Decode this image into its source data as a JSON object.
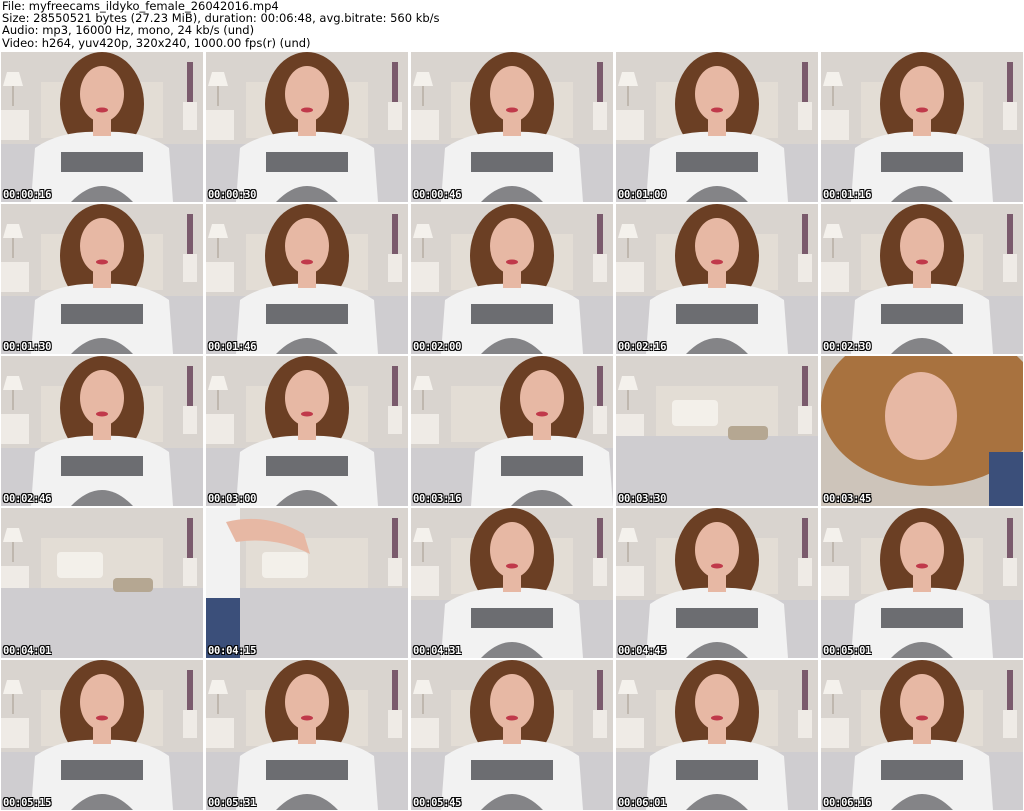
{
  "header": {
    "file_line": "File: myfreecams_ildyko_female_26042016.mp4",
    "size_line": "Size: 28550521 bytes (27.23 MiB), duration: 00:06:48, avg.bitrate: 560 kb/s",
    "audio_line": "Audio: mp3, 16000 Hz, mono, 24 kb/s (und)",
    "video_line": "Video: h264, yuv420p, 320x240, 1000.00 fps(r) (und)"
  },
  "thumbnails": [
    {
      "time": "00:00:16",
      "scene": "person"
    },
    {
      "time": "00:00:30",
      "scene": "person"
    },
    {
      "time": "00:00:46",
      "scene": "person"
    },
    {
      "time": "00:01:00",
      "scene": "person"
    },
    {
      "time": "00:01:16",
      "scene": "person"
    },
    {
      "time": "00:01:30",
      "scene": "person"
    },
    {
      "time": "00:01:46",
      "scene": "person"
    },
    {
      "time": "00:02:00",
      "scene": "person"
    },
    {
      "time": "00:02:16",
      "scene": "person"
    },
    {
      "time": "00:02:30",
      "scene": "person"
    },
    {
      "time": "00:02:46",
      "scene": "person"
    },
    {
      "time": "00:03:00",
      "scene": "person"
    },
    {
      "time": "00:03:16",
      "scene": "person-leaning"
    },
    {
      "time": "00:03:30",
      "scene": "empty-bed"
    },
    {
      "time": "00:03:45",
      "scene": "close-up"
    },
    {
      "time": "00:04:01",
      "scene": "empty-bed"
    },
    {
      "time": "00:04:15",
      "scene": "arm-bed"
    },
    {
      "time": "00:04:31",
      "scene": "person"
    },
    {
      "time": "00:04:45",
      "scene": "person"
    },
    {
      "time": "00:05:01",
      "scene": "person"
    },
    {
      "time": "00:05:15",
      "scene": "person"
    },
    {
      "time": "00:05:31",
      "scene": "person"
    },
    {
      "time": "00:05:45",
      "scene": "person"
    },
    {
      "time": "00:06:01",
      "scene": "person"
    },
    {
      "time": "00:06:16",
      "scene": "person"
    }
  ],
  "colors": {
    "wall": "#d9d4cf",
    "headboard": "#e3ddd5",
    "bed": "#cfcdd0",
    "hair": "#6b3f24",
    "skin": "#e7b8a4",
    "shirt": "#f2f2f2",
    "shirt_print": "#55565a",
    "jeans": "#3b4f7a"
  }
}
